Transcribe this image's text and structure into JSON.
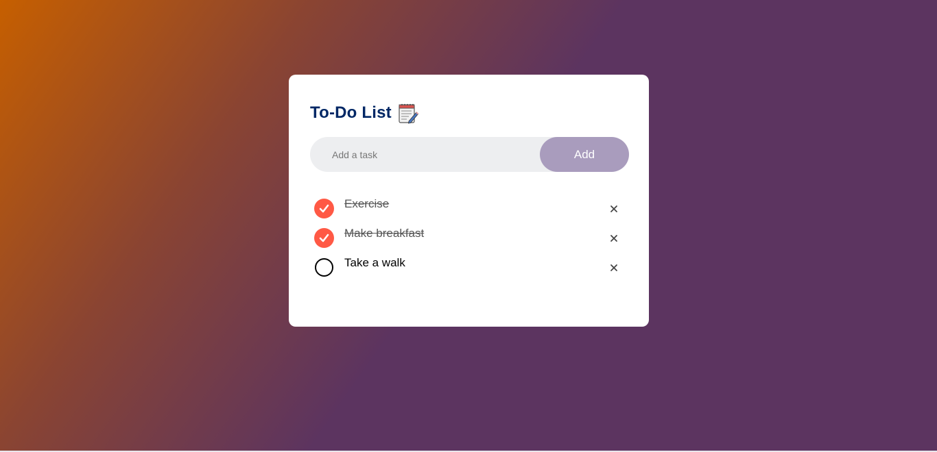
{
  "app": {
    "title": "To-Do List",
    "title_icon": "spiral-notepad-icon"
  },
  "input": {
    "placeholder": "Add a task",
    "value": "",
    "add_label": "Add"
  },
  "tasks": [
    {
      "text": "Exercise",
      "checked": true
    },
    {
      "text": "Make breakfast",
      "checked": true
    },
    {
      "text": "Take a walk",
      "checked": false
    }
  ],
  "colors": {
    "title": "#002765",
    "accent": "#ff5945",
    "add_button": "#a99cbd",
    "input_bg": "#edeef0",
    "background_start": "#c65f00",
    "background_end": "#5c3460"
  }
}
